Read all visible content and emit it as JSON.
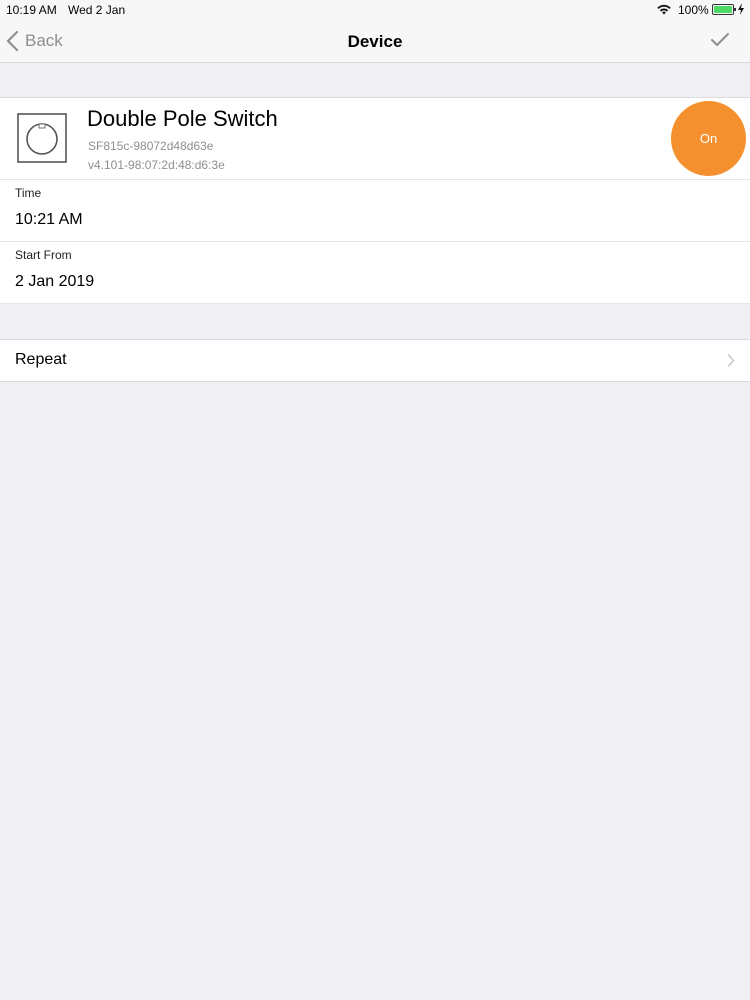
{
  "status_bar": {
    "time": "10:19 AM",
    "date": "Wed 2 Jan",
    "battery_percent": "100%",
    "battery_color": "#4cd964"
  },
  "nav": {
    "back_label": "Back",
    "title": "Device",
    "confirm_icon": "checkmark-icon"
  },
  "device": {
    "name": "Double Pole Switch",
    "id": "SF815c-98072d48d63e",
    "version": "v4.101-98:07:2d:48:d6:3e",
    "icon": "power-switch-icon",
    "state_label": "On",
    "state_color": "#f5902f"
  },
  "fields": {
    "time": {
      "label": "Time",
      "value": "10:21 AM"
    },
    "start_from": {
      "label": "Start From",
      "value": "2 Jan 2019"
    }
  },
  "repeat": {
    "label": "Repeat",
    "icon": "chevron-right-icon"
  }
}
